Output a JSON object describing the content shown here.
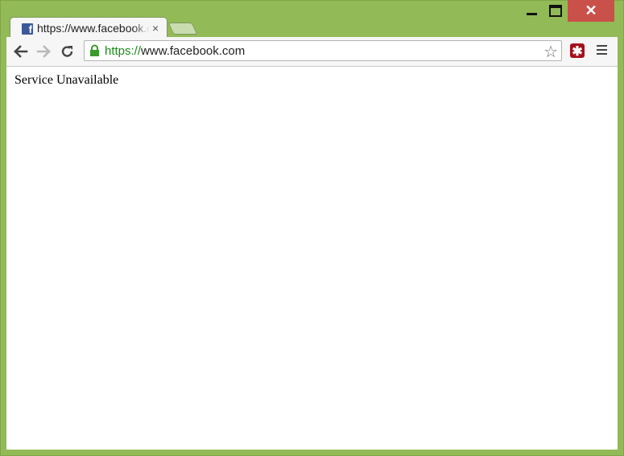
{
  "window": {
    "controls": {
      "minimize_icon": "minimize-icon",
      "maximize_icon": "maximize-icon",
      "close_icon": "close-icon",
      "close_label": "✕",
      "close_color": "#c9514a"
    },
    "frame_color": "#92ba56"
  },
  "tabs": [
    {
      "title": "https://www.facebook.com",
      "favicon": "facebook-icon",
      "close_label": "×",
      "active": true
    }
  ],
  "toolbar": {
    "back_icon": "back-arrow-icon",
    "forward_icon": "forward-arrow-icon",
    "reload_icon": "reload-icon",
    "address": {
      "scheme": "https://",
      "host": "www.facebook.com",
      "secure_icon": "lock-icon",
      "scheme_color": "#1a8a1a"
    },
    "bookmark_icon": "star-icon",
    "bookmark_label": "☆",
    "extension_icon": "lastpass-icon",
    "extension_label": "✱",
    "menu_icon": "hamburger-menu-icon"
  },
  "page": {
    "body_text": "Service Unavailable"
  }
}
